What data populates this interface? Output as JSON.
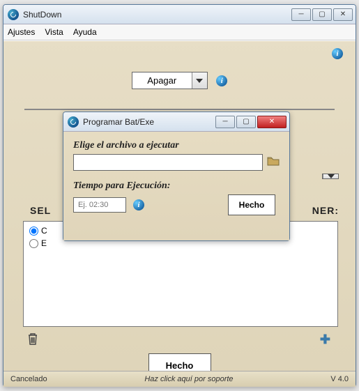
{
  "main": {
    "title": "ShutDown",
    "menu": {
      "ajustes": "Ajustes",
      "vista": "Vista",
      "ayuda": "Ayuda"
    },
    "action_selected": "Apagar",
    "section_left": "SEL",
    "section_right": "NER:",
    "radios": {
      "opt1": "C",
      "opt2": "E"
    },
    "done_label": "Hecho",
    "status_left": "Cancelado",
    "status_center": "Haz click aquí por soporte",
    "status_right": "V 4.0"
  },
  "dialog": {
    "title": "Programar Bat/Exe",
    "file_label": "Elige el archivo a ejecutar",
    "file_value": "",
    "time_label": "Tiempo para Ejecución:",
    "time_placeholder": "Ej. 02:30",
    "done_label": "Hecho"
  }
}
